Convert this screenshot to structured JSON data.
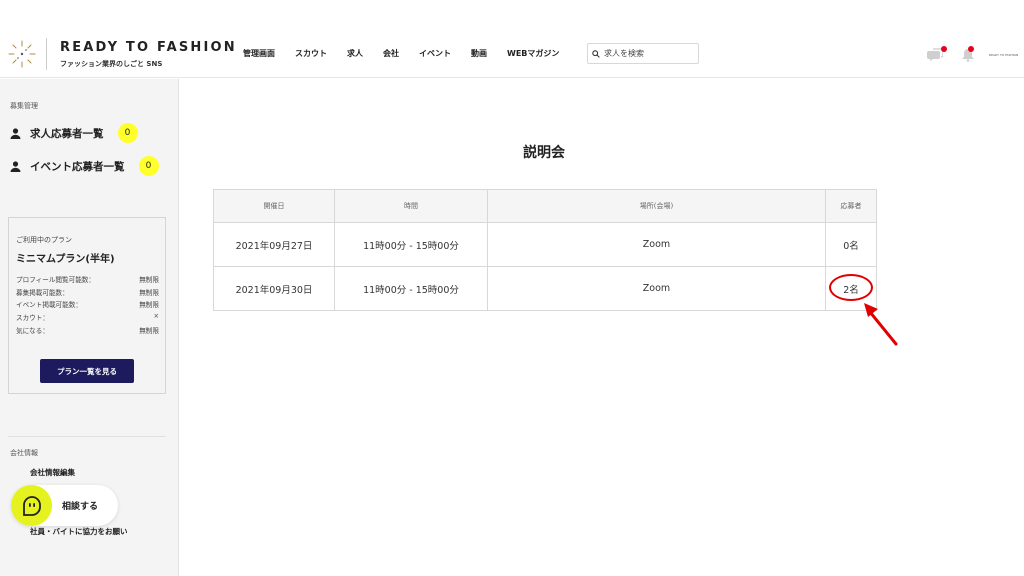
{
  "header": {
    "brand_title": "READY TO FASHION",
    "brand_subtitle": "ファッション業界のしごと SNS",
    "nav": [
      "管理画面",
      "スカウト",
      "求人",
      "会社",
      "イベント",
      "動画",
      "WEBマガジン"
    ],
    "search_placeholder": "求人を検索",
    "mini_logo": "READY TO FASHION",
    "notification_color": "#e8001c"
  },
  "sidebar": {
    "section_recruit": "募集管理",
    "links": [
      {
        "label": "求人応募者一覧",
        "count": "0"
      },
      {
        "label": "イベント応募者一覧",
        "count": "0"
      }
    ],
    "plan": {
      "label": "ご利用中のプラン",
      "name": "ミニマムプラン(半年)",
      "rows": [
        {
          "key": "プロフィール閲覧可能数：",
          "value": "無制限"
        },
        {
          "key": "募集掲載可能数：",
          "value": "無制限"
        },
        {
          "key": "イベント掲載可能数：",
          "value": "無制限"
        },
        {
          "key": "スカウト：",
          "value": "×"
        },
        {
          "key": "気になる：",
          "value": "無制限"
        }
      ],
      "button": "プラン一覧を見る"
    },
    "section_company": "会社情報",
    "company_links": [
      "会社情報編集",
      "社員・バイトに協力をお願い"
    ]
  },
  "chat": {
    "label": "相談する",
    "color": "#e5f21f"
  },
  "main": {
    "title": "説明会",
    "table": {
      "headers": [
        "開催日",
        "時間",
        "場所(会場)",
        "応募者"
      ],
      "rows": [
        {
          "date": "2021年09月27日",
          "time": "11時00分 - 15時00分",
          "place": "Zoom",
          "applicants": "0名"
        },
        {
          "date": "2021年09月30日",
          "time": "11時00分 - 15時00分",
          "place": "Zoom",
          "applicants": "2名"
        }
      ]
    },
    "annotation_color": "#e10000"
  },
  "colors": {
    "accent": "#1d1b5e",
    "badge": "#ffff2b"
  }
}
